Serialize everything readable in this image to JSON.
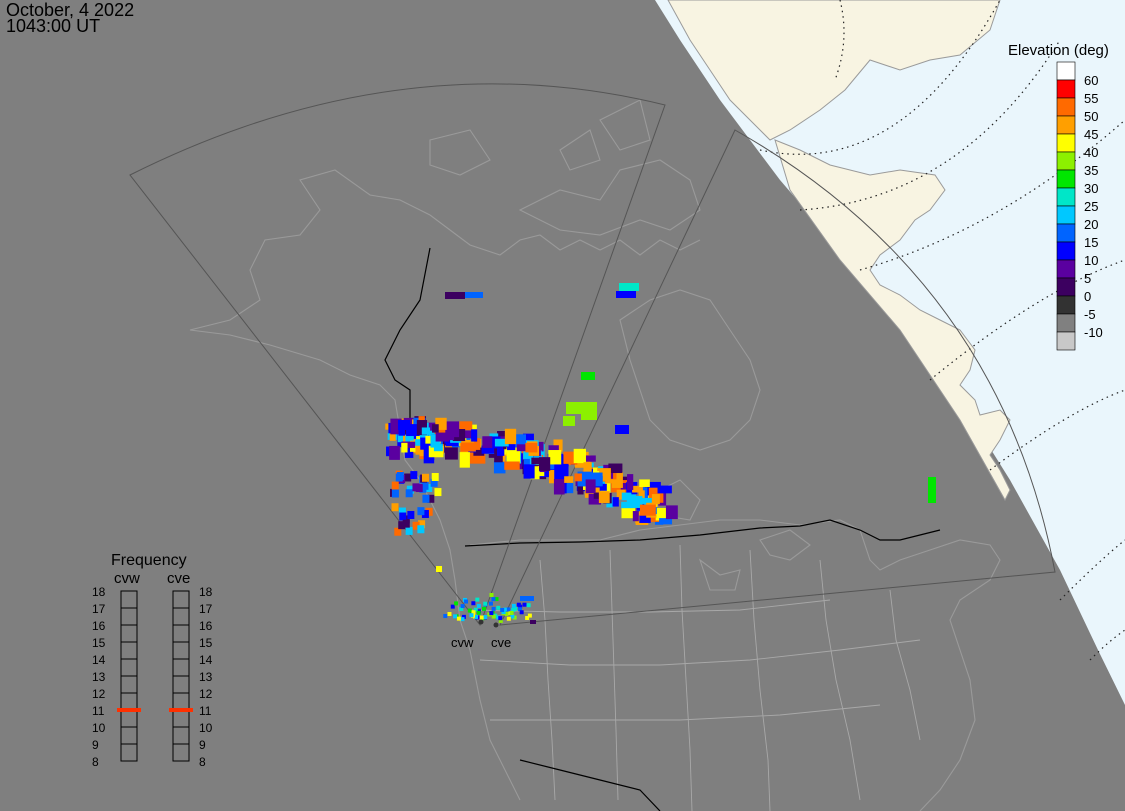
{
  "header": {
    "date": "October, 4 2022",
    "time": "1043:00 UT"
  },
  "colors": {
    "background": "#7f7f7f",
    "sunlit_land": "#f8f4e2",
    "sunlit_ocean": "#eaf6fc",
    "map_lines": "#9a9a9a",
    "fov_lines": "#555555",
    "border": "#000000",
    "frequency_marker": "#ff3000"
  },
  "elevation_legend": {
    "title": "Elevation (deg)",
    "labels": [
      "60",
      "55",
      "50",
      "45",
      "40",
      "35",
      "30",
      "25",
      "20",
      "15",
      "10",
      "5",
      "0",
      "-5",
      "-10"
    ],
    "colors": [
      "#ffffff",
      "#ff0000",
      "#ff6a00",
      "#ff9f00",
      "#ffff00",
      "#8cf000",
      "#00e600",
      "#00e6c8",
      "#00c8ff",
      "#0064ff",
      "#0000ff",
      "#5a00a0",
      "#3c0060",
      "#323232",
      "#808080",
      "#c8c8c8"
    ]
  },
  "frequency_panel": {
    "title": "Frequency",
    "radars": [
      {
        "name": "cvw",
        "current_mhz": 11
      },
      {
        "name": "cve",
        "current_mhz": 11
      }
    ],
    "ticks": [
      "18",
      "17",
      "16",
      "15",
      "14",
      "13",
      "12",
      "11",
      "10",
      "9",
      "8"
    ]
  },
  "radar_sites": [
    {
      "name": "cvw"
    },
    {
      "name": "cve"
    }
  ]
}
